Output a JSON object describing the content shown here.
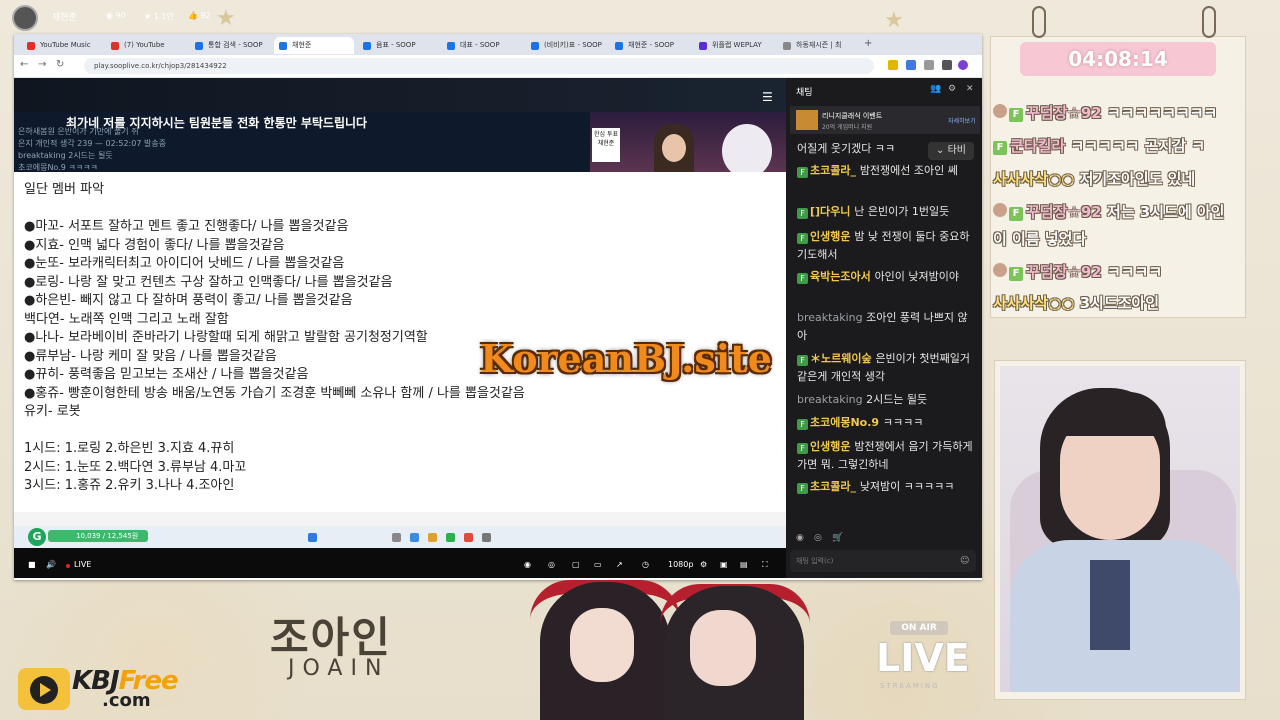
{
  "browser": {
    "tabs": [
      {
        "label": "YouTube Music",
        "color": "#e52d27"
      },
      {
        "label": "(7) YouTube",
        "color": "#e52d27"
      },
      {
        "label": "통합 검색 - SOOP",
        "color": "#1a73e8"
      },
      {
        "label": "채현준",
        "color": "#1a73e8"
      },
      {
        "label": "음표 - SOOP",
        "color": "#1a73e8"
      },
      {
        "label": "대표 - SOOP",
        "color": "#1a73e8"
      },
      {
        "label": "(비비키)표 - SOOP",
        "color": "#1a73e8"
      },
      {
        "label": "채현준 - SOOP",
        "color": "#1a73e8"
      },
      {
        "label": "위플랩 WEPLAY",
        "color": "#5b2bd6"
      },
      {
        "label": "하동재시즌 | 최",
        "color": "#888888"
      }
    ],
    "url": "play.sooplive.co.kr/chjop3/281434922"
  },
  "stream": {
    "streamer": "채현준",
    "viewers": "90",
    "stars": "1.1만",
    "likes": "92",
    "title": "최가네 저를 지지하시는 팀원분들 전화 한통만 부탁드립니다",
    "faint1": "은하새봄원 은반이가 기만에 풀기 쥐",
    "faint2": "은지 개인적 생각 239 — 02:52:07 발송중",
    "faint3": "breaktaking 2시드는 될듯",
    "faint4": "초코에몽No.9 ㅋㅋㅋㅋ",
    "cam_sign": "한심 투표 채현준"
  },
  "doc": {
    "lines": [
      "일단 멤버 파악",
      "",
      "●마꼬- 서포트 잘하고 멘트 좋고 진행좋다/ 나를 뽑을것같음",
      "●지효- 인맥 넓다 경험이 좋다/ 나를 뽑을것같음",
      "●눈또- 보라캐릭터최고 아이디어 낫베드 / 나를 뽑을것같음",
      "●로링- 나랑 잘 맞고 컨텐츠 구상 잘하고 인맥좋다/ 나를 뽑을것같음",
      "●하은빈- 빼지 않고 다 잘하며 풍력이 좋고/ 나를 뽑을것같음",
      "백다연- 노래쪽 인맥 그리고 노래 잘함",
      "●나나- 보라베이비 준바라기 나랑할때 되게 해맑고 발랄함 공기청정기역할",
      "●류부남- 나랑 케미 잘 맞음 / 나를 뽑을것같음",
      "●뀨히- 풍력좋음 믿고보는 조새산 / 나를 뽑을것같음",
      "●홍쥬- 빵훈이형한테 방송 배움/노연동 가습기 조경훈 박뻬뻬 소유나 함께 / 나를 뽑을것같음",
      "유키- 로봇",
      "",
      "1시드: 1.로링 2.하은빈 3.지효 4.뀨히",
      "2시드: 1.눈또 2.백다연 3.류부남 4.마꼬",
      "3시드: 1.홍쥬 2.유키 3.나나 4.조아인"
    ],
    "progress_label": "10,039 / 12,545원"
  },
  "player": {
    "live": "LIVE",
    "quality": "1080p"
  },
  "chat": {
    "title": "채팅",
    "event_title": "리니지클래식 이벤트",
    "event_sub": "20억 게임머니 지원",
    "event_more": "자세히보기",
    "tabi": "타비",
    "input_placeholder": "채팅 입력(c)",
    "messages": [
      {
        "nick": "",
        "text": "어질게 웃기겠다 ㅋㅋ",
        "gray": false
      },
      {
        "nick": "초코콜라_",
        "text": "밤전쟁에선 조아인 쎄",
        "gray": false
      },
      {
        "nick": "[]다우니",
        "text": "난 은빈이가 1번일듯",
        "gray": false
      },
      {
        "nick": "인생행운",
        "text": "밤 낮 전쟁이 둘다 중요하기도해서",
        "gray": false
      },
      {
        "nick": "육박는조아서",
        "text": "아인이 낮져밤이야",
        "gray": false
      },
      {
        "nick": "breaktaking",
        "text": "조아인 풍력 나쁘지 않아",
        "gray": true
      },
      {
        "nick": "＊노르웨이숲",
        "text": "은빈이가 첫번째일거 같은게 개인적 생각",
        "gray": false
      },
      {
        "nick": "breaktaking",
        "text": "2시드는 될듯",
        "gray": true
      },
      {
        "nick": "초코에몽No.9",
        "text": "ㅋㅋㅋㅋ",
        "gray": false
      },
      {
        "nick": "인생행운",
        "text": "밤전쟁에서 음기 가득하게 가면 뭐. 그렇긴하네",
        "gray": false
      },
      {
        "nick": "초코콜라_",
        "text": "낮져밤이 ㅋㅋㅋㅋㅋ",
        "gray": false
      }
    ]
  },
  "overlay": {
    "timer": "04:08:14",
    "messages": [
      {
        "nick": "꾸덤장☆92",
        "text": "ㅋㅋㅋㅋㅋㅋㅋㅋ",
        "badge": "ab"
      },
      {
        "nick": "쿤타킬라",
        "text": "ㅋㅋㅋㅋㅋ 곤지감 ㅋ",
        "badge": "fb"
      },
      {
        "nick": "사사사삭○○",
        "text": "저기조아인도 있네",
        "badge": ""
      },
      {
        "nick": "꾸덤장☆92",
        "text": "저는 3시드에 아인",
        "badge": "ab"
      },
      {
        "nick": "",
        "text": "이 이름 넣었다",
        "badge": ""
      },
      {
        "nick": "꾸덤장☆92",
        "text": "ㅋㅋㅋㅋ",
        "badge": "ab"
      },
      {
        "nick": "사사사삭○○",
        "text": "3시드조아인",
        "badge": ""
      }
    ]
  },
  "branding": {
    "name_ko": "조아인",
    "name_en": "JOAIN",
    "on_air": "ON AIR",
    "live": "LIVE",
    "streaming": "STREAMING",
    "kbj_prefix": "KBJ",
    "kbj_free": "Free",
    "kbj_com": ".com",
    "watermark": "KoreanBJ.site"
  }
}
